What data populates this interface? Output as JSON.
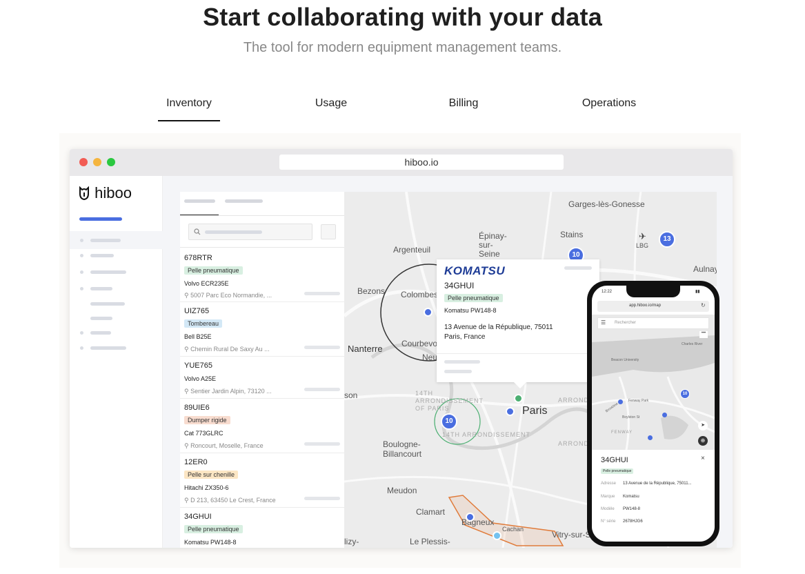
{
  "hero": {
    "title": "Start collaborating with your data",
    "subtitle": "The tool for modern equipment management teams."
  },
  "tabs": [
    {
      "label": "Inventory",
      "active": true
    },
    {
      "label": "Usage",
      "active": false
    },
    {
      "label": "Billing",
      "active": false
    },
    {
      "label": "Operations",
      "active": false
    }
  ],
  "browser": {
    "url": "hiboo.io"
  },
  "app": {
    "logo_text": "hiboo"
  },
  "colors": {
    "accent": "#4a6ee0",
    "brand": "#1f1f1f"
  },
  "list": [
    {
      "id": "678RTR",
      "tag": "Pelle pneumatique",
      "tag_color": "#d8efe1",
      "model": "Volvo ECR235E",
      "address": "5007 Parc Eco Normandie, ..."
    },
    {
      "id": "UIZ765",
      "tag": "Tombereau",
      "tag_color": "#d3e8f6",
      "model": "Bell B25E",
      "address": "Chemin Rural De Saxy Au ..."
    },
    {
      "id": "YUE765",
      "tag": "",
      "tag_color": "",
      "model": "Volvo A25E",
      "address": "Sentier Jardin Alpin, 73120 ..."
    },
    {
      "id": "89UIE6",
      "tag": "Dumper rigide",
      "tag_color": "#f8dccf",
      "model": "Cat 773GLRC",
      "address": "Roncourt, Moselle, France"
    },
    {
      "id": "12ER0",
      "tag": "Pelle sur chenille",
      "tag_color": "#fce6c4",
      "model": "Hitachi ZX350-6",
      "address": "D 213, 63450 Le Crest, France"
    },
    {
      "id": "34GHUI",
      "tag": "Pelle pneumatique",
      "tag_color": "#d8efe1",
      "model": "Komatsu PW148-8",
      "address": ""
    }
  ],
  "map": {
    "labels": [
      "Garges-lès-Gonesse",
      "Épinay-sur-Seine",
      "Stains",
      "Argenteuil",
      "LBG",
      "Aulnay-sous-Bois",
      "Bezons",
      "Colombes",
      "Nanterre",
      "Courbevoie",
      "Neuilly-sur-Seine",
      "Paris",
      "Boulogne-Billancourt",
      "Meudon",
      "Clamart",
      "Bagneux",
      "Cachan",
      "Vitry-sur-Seine",
      "Le Plessis-",
      "14TH ARRONDISSEMENT OF PARIS",
      "14TH ARRONDISSEMENT",
      "ARROND",
      "ARROND",
      "son",
      "lizy-"
    ],
    "clusters": [
      "10",
      "13",
      "10"
    ]
  },
  "popup": {
    "brand": "KOMATSU",
    "id": "34GHUI",
    "tag": "Pelle pneumatique",
    "model": "Komatsu PW148-8",
    "address_line1": "13 Avenue de la République, 75011",
    "address_line2": "Paris, France"
  },
  "phone": {
    "time": "12:22",
    "url": "app.hiboo.io/map",
    "search_placeholder": "Rechercher",
    "map_labels": [
      "Beacon University",
      "Fenway Park",
      "Boylston St",
      "Brookline Av",
      "FENWAY",
      "Charles River"
    ],
    "cluster": "10",
    "detail": {
      "id": "34GHUI",
      "tag": "Pelle pneumatique",
      "rows": [
        {
          "label": "Adresse",
          "value": "13 Avenue de la République, 75011..."
        },
        {
          "label": "Marque",
          "value": "Komatsu"
        },
        {
          "label": "Modèle",
          "value": "PW148-8"
        },
        {
          "label": "N° série",
          "value": "2678HJG6"
        }
      ]
    }
  }
}
